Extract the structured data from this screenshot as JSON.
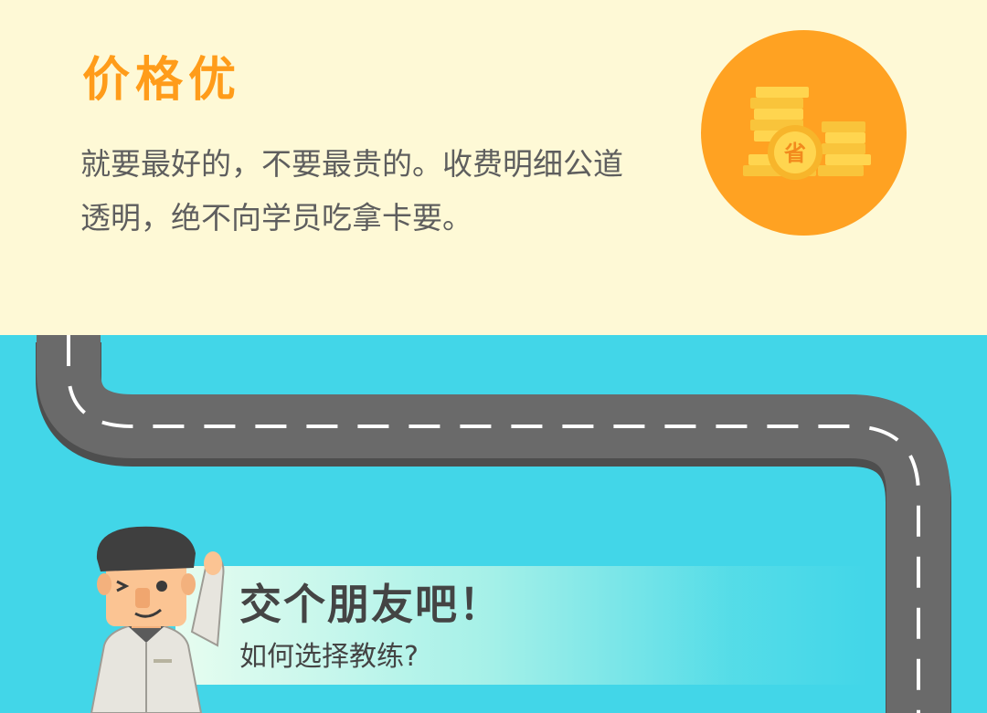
{
  "feature": {
    "title": "价格优",
    "description_lines": [
      "就要最好的，不要最贵的。收费明细公道",
      "透明，绝不向学员吃拿卡要。"
    ],
    "icon": "coins-save-icon",
    "coin_label": "省"
  },
  "banner": {
    "title": "交个朋友吧！",
    "subtitle": "如何选择教练?"
  },
  "colors": {
    "top_background": "#FEF9D6",
    "accent_orange": "#FF9C1A",
    "sky_cyan": "#42D6E8",
    "road_gray": "#6A6A6A"
  }
}
